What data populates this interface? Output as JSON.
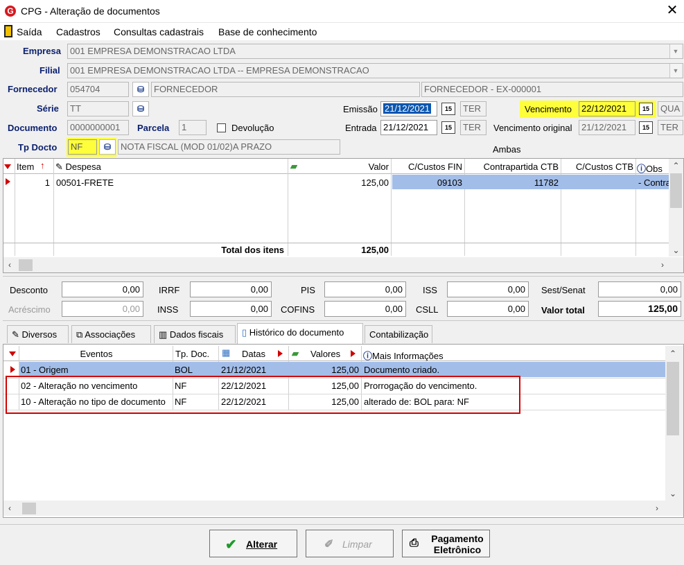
{
  "window": {
    "title": "CPG - Alteração de documentos",
    "logo_letter": "G"
  },
  "menu": [
    "Saída",
    "Cadastros",
    "Consultas cadastrais",
    "Base de conhecimento"
  ],
  "form": {
    "empresa_label": "Empresa",
    "empresa_value": "001 EMPRESA DEMONSTRACAO LTDA",
    "filial_label": "Filial",
    "filial_value": "001 EMPRESA DEMONSTRACAO LTDA -- EMPRESA DEMONSTRACAO",
    "fornecedor_label": "Fornecedor",
    "fornecedor_code": "054704",
    "fornecedor_name": "FORNECEDOR",
    "fornecedor_ex": "FORNECEDOR - EX-000001",
    "serie_label": "Série",
    "serie_value": "TT",
    "emissao_label": "Emissão",
    "emissao_value": "21/12/2021",
    "emissao_day": "TER",
    "vencimento_label": "Vencimento",
    "vencimento_value": "22/12/2021",
    "vencimento_day": "QUA",
    "documento_label": "Documento",
    "documento_value": "0000000001",
    "parcela_label": "Parcela",
    "parcela_value": "1",
    "devolucao_label": "Devolução",
    "entrada_label": "Entrada",
    "entrada_value": "21/12/2021",
    "entrada_day": "TER",
    "venc_original_label": "Vencimento original",
    "venc_original_value": "21/12/2021",
    "venc_original_day": "TER",
    "tpdocto_label": "Tp Docto",
    "tpdocto_value": "NF",
    "tpdocto_desc": "NOTA FISCAL (MOD 01/02)A PRAZO",
    "ambas": "Ambas",
    "cal_icon_text": "15"
  },
  "items_grid": {
    "headers": {
      "item": "Item",
      "despesa": "Despesa",
      "valor": "Valor",
      "ccfin": "C/Custos FIN",
      "contrapartida": "Contrapartida CTB",
      "ccctb": "C/Custos CTB",
      "obs": "Obs"
    },
    "rows": [
      {
        "item": "1",
        "despesa": "00501-FRETE",
        "valor": "125,00",
        "ccfin": "09103",
        "contrapartida": "11782",
        "ccctb": "",
        "obs": "- Contra"
      }
    ],
    "total_label": "Total dos itens",
    "total_value": "125,00"
  },
  "totals": {
    "desconto_label": "Desconto",
    "desconto": "0,00",
    "acrescimo_label": "Acréscimo",
    "acrescimo": "0,00",
    "irrf_label": "IRRF",
    "irrf": "0,00",
    "inss_label": "INSS",
    "inss": "0,00",
    "pis_label": "PIS",
    "pis": "0,00",
    "cofins_label": "COFINS",
    "cofins": "0,00",
    "iss_label": "ISS",
    "iss": "0,00",
    "csll_label": "CSLL",
    "csll": "0,00",
    "sest_label": "Sest/Senat",
    "sest": "0,00",
    "valor_total_label": "Valor total",
    "valor_total": "125,00"
  },
  "tabs": [
    "Diversos",
    "Associações",
    "Dados fiscais",
    "Histórico do documento",
    "Contabilização"
  ],
  "history_grid": {
    "headers": {
      "eventos": "Eventos",
      "tpdoc": "Tp. Doc.",
      "datas": "Datas",
      "valores": "Valores",
      "info": "Mais Informações"
    },
    "rows": [
      {
        "evento": "01 - Origem",
        "tpdoc": "BOL",
        "data": "21/12/2021",
        "valor": "125,00",
        "info": "Documento criado."
      },
      {
        "evento": "02 - Alteração no vencimento",
        "tpdoc": "NF",
        "data": "22/12/2021",
        "valor": "125,00",
        "info": "Prorrogação do vencimento."
      },
      {
        "evento": "10 - Alteração no tipo de documento",
        "tpdoc": "NF",
        "data": "22/12/2021",
        "valor": "125,00",
        "info": "alterado de: BOL para: NF"
      }
    ]
  },
  "buttons": {
    "alterar": "Alterar",
    "limpar": "Limpar",
    "pagamento_line1": "Pagamento",
    "pagamento_line2": "Eletrônico"
  },
  "colors": {
    "selection": "#a2bde8",
    "highlight_yellow": "#fffe3a",
    "red_frame": "#d00000",
    "label_blue": "#0a1f6e"
  }
}
